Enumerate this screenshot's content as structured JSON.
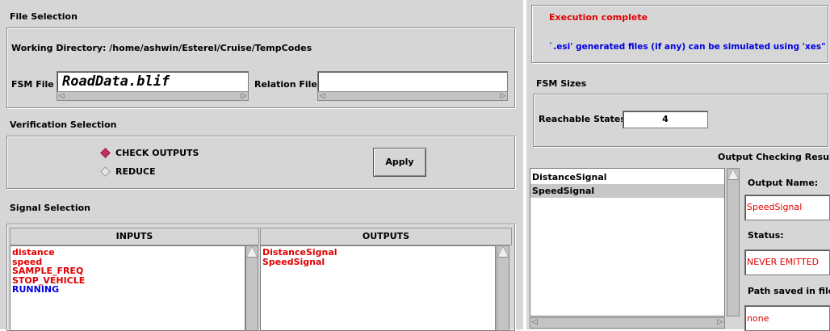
{
  "file_selection": {
    "title": "File Selection",
    "working_directory": "Working Directory: /home/ashwin/Esterel/Cruise/TempCodes",
    "fsm_file_label": "FSM File",
    "fsm_file_value": "RoadData.blif",
    "relation_file_label": "Relation File",
    "relation_file_value": ""
  },
  "verification": {
    "title": "Verification Selection",
    "options": [
      "CHECK OUTPUTS",
      "REDUCE"
    ],
    "selected": "CHECK OUTPUTS",
    "apply_label": "Apply",
    "selected_color": "#c03060"
  },
  "signal_selection": {
    "title": "Signal Selection",
    "inputs_header": "INPUTS",
    "outputs_header": "OUTPUTS",
    "inputs": [
      {
        "name": "distance",
        "color": "red"
      },
      {
        "name": "speed",
        "color": "red"
      },
      {
        "name": "SAMPLE_FREQ",
        "color": "red"
      },
      {
        "name": "STOP_VEHICLE",
        "color": "red"
      },
      {
        "name": "RUNNING",
        "color": "blue"
      }
    ],
    "outputs": [
      {
        "name": "DistanceSignal",
        "color": "red"
      },
      {
        "name": "SpeedSignal",
        "color": "red"
      }
    ]
  },
  "execution": {
    "status": "Execution complete",
    "message": "`.esi' generated files (if any) can be simulated using 'xes\""
  },
  "fsm_sizes": {
    "title": "FSM Sizes",
    "reachable_label": "Reachable States",
    "reachable_value": "4"
  },
  "output_checking": {
    "title": "Output Checking Results",
    "signals": [
      "DistanceSignal",
      "SpeedSignal"
    ],
    "selected_signal": "SpeedSignal",
    "output_name_label": "Output Name:",
    "output_name_value": "SpeedSignal",
    "status_label": "Status:",
    "status_value": "NEVER EMITTED",
    "path_label": "Path saved in file:",
    "path_value": "none"
  }
}
